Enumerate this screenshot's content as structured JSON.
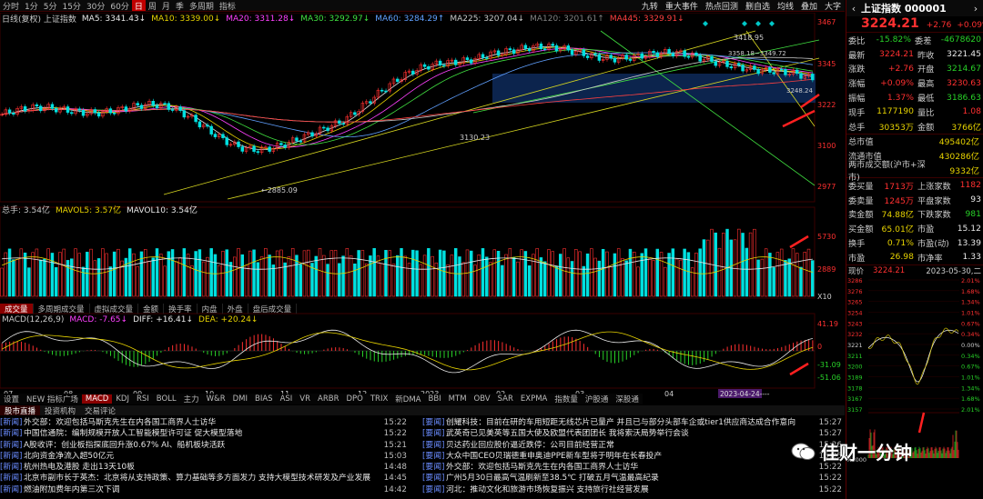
{
  "toolbar": {
    "items": [
      "分时",
      "1分",
      "5分",
      "15分",
      "30分",
      "60分",
      "日",
      "周",
      "月",
      "季",
      "多周期",
      "指标"
    ],
    "active_index": 6,
    "right_items": [
      "九转",
      "重大事件",
      "热点回测",
      "删自选",
      "均线",
      "叠加",
      "大字"
    ]
  },
  "main_legend": [
    {
      "text": "日线(复权) 上证指数",
      "color": "#c8c8c8"
    },
    {
      "text": "MA5: 3341.43↓",
      "color": "#e8e8e8"
    },
    {
      "text": "MA10: 3339.00↓",
      "color": "#e6d200"
    },
    {
      "text": "MA20: 3311.28↓",
      "color": "#ff40ff"
    },
    {
      "text": "MA30: 3292.97↓",
      "color": "#40e040"
    },
    {
      "text": "MA60: 3284.29↑",
      "color": "#60a0ff"
    },
    {
      "text": "MA225: 3207.04↓",
      "color": "#c8c8c8"
    },
    {
      "text": "MA120: 3201.61↑",
      "color": "#808080"
    },
    {
      "text": "MA445: 3329.91↓",
      "color": "#ff4040"
    }
  ],
  "price_axis": [
    "3467",
    "3345",
    "3222",
    "3100",
    "2977"
  ],
  "vol_axis": [
    "5730",
    "2889",
    "X10"
  ],
  "macd_axis": [
    "41.19",
    "0",
    "-31.09",
    "-51.06"
  ],
  "annotations": {
    "high": "3418.95",
    "low": "←2885.09",
    "mid": "3130.23",
    "range": "3358.18~3349.72",
    "tag": "3248.24"
  },
  "vol_legend": [
    {
      "text": "总手: 3.54亿",
      "color": "#c8c8c8"
    },
    {
      "text": "MAVOL5: 3.57亿",
      "color": "#e6d200"
    },
    {
      "text": "MAVOL10: 3.54亿",
      "color": "#e8e8e8"
    }
  ],
  "indicator_tabs": [
    "成交量",
    "多周期成交量",
    "虚拟成交量",
    "金额",
    "换手率",
    "内盘",
    "外盘",
    "盘后成交量"
  ],
  "indicator_tabs_active": 0,
  "macd_legend": [
    {
      "text": "MACD(12,26,9)",
      "color": "#c8c8c8"
    },
    {
      "text": "MACD: -7.65↓",
      "color": "#ff40ff"
    },
    {
      "text": "DIFF: +16.41↓",
      "color": "#e8e8e8"
    },
    {
      "text": "DEA: +20.24↓",
      "color": "#e6d200"
    }
  ],
  "indicator_explain": "指标说明",
  "date_axis": [
    "07",
    "08",
    "09",
    "10",
    "11",
    "12",
    "2023",
    "02",
    "03",
    "04"
  ],
  "date_highlight": "2023-04-24----",
  "bottom_tabs": [
    "设置",
    "NEW 指标广场",
    "MACD",
    "KDJ",
    "RSI",
    "BOLL",
    "主力",
    "W&R",
    "DMI",
    "BIAS",
    "ASI",
    "VR",
    "ARBR",
    "DPO",
    "TRIX",
    "新DMA",
    "BBI",
    "MTM",
    "OBV",
    "SAR",
    "EXPMA",
    "指数量",
    "沪股通",
    "深股通"
  ],
  "bottom_tabs_active": 2,
  "news_tabs": [
    "股市直播",
    "投资机构",
    "交易评论"
  ],
  "news_left": [
    {
      "tag": "[新闻]",
      "title": "外交部：欢迎包括马斯克先生在内各国工商界人士访华",
      "time": "15:22"
    },
    {
      "tag": "[新闻]",
      "title": "中国信通院：编制规模开放人工智能模型许可证 促大模型落地",
      "time": "15:22"
    },
    {
      "tag": "[新闻]",
      "title": "A股收评：创业板指探底回升涨0.67% AI、船机板块活跃",
      "time": "15:21"
    },
    {
      "tag": "[新闻]",
      "title": "北向资金净流入超50亿元",
      "time": "15:03"
    },
    {
      "tag": "[新闻]",
      "title": "杭州热电及港股 走出13天10板",
      "time": "14:48"
    },
    {
      "tag": "[新闻]",
      "title": "北京市副市长于英杰：北京将从支持政策、算力基础等多方面发力 支持大模型技术研发及产业发展",
      "time": "14:45"
    },
    {
      "tag": "[新闻]",
      "title": "燃油附加费年内第三次下调",
      "time": "14:42"
    }
  ],
  "news_right": [
    {
      "tag": "[要闻]",
      "title": "创耀科技：目前在研的车用短距无线芯片已量产 并且已与部分头部车企或tier1供应商达成合作意向",
      "time": "15:27"
    },
    {
      "tag": "[要闻]",
      "title": "武英奇已见美英等五国大使及欧盟代表团团长 我将索沃局势举行会谈",
      "time": "15:27"
    },
    {
      "tag": "[要闻]",
      "title": "贝达药业回应股价逼近跌停：公司目前经营正常",
      "time": "15:26"
    },
    {
      "tag": "[要闻]",
      "title": "大众中国CEO贝瑞德重申奥迪PPE新车型将于明年在长春投产",
      "time": "15:25"
    },
    {
      "tag": "[要闻]",
      "title": "外交部：欢迎包括马斯克先生在内各国工商界人士访华",
      "time": "15:22"
    },
    {
      "tag": "[要闻]",
      "title": "广州5月30日最高气温刷新至38.5℃ 打破五月气温最高纪录",
      "time": "15:22"
    },
    {
      "tag": "[要闻]",
      "title": "河北：推动文化和旅游市场恢复振兴 支持旅行社经营发展",
      "time": "15:22"
    }
  ],
  "quote": {
    "name": "上证指数 000001",
    "price": "3224.21",
    "change": "+2.76",
    "pct": "+0.09%",
    "rows": [
      {
        "l1": "委比",
        "v1": "-15.82%",
        "c1": "grn",
        "l2": "委差",
        "v2": "-4678620",
        "c2": "grn"
      },
      {
        "l1": "最新",
        "v1": "3224.21",
        "c1": "red",
        "l2": "昨收",
        "v2": "3221.45",
        "c2": "wht"
      },
      {
        "l1": "涨跌",
        "v1": "+2.76",
        "c1": "red",
        "l2": "开盘",
        "v2": "3214.67",
        "c2": "grn"
      },
      {
        "l1": "涨幅",
        "v1": "+0.09%",
        "c1": "red",
        "l2": "最高",
        "v2": "3230.63",
        "c2": "red"
      },
      {
        "l1": "振幅",
        "v1": "1.37%",
        "c1": "red",
        "l2": "最低",
        "v2": "3186.63",
        "c2": "grn"
      },
      {
        "l1": "现手",
        "v1": "1177190",
        "c1": "yel",
        "l2": "量比",
        "v2": "1.08",
        "c2": "red"
      },
      {
        "l1": "总手",
        "v1": "30353万",
        "c1": "yel",
        "l2": "金额",
        "v2": "3766亿",
        "c2": "yel"
      }
    ],
    "stats": [
      {
        "l": "总市值",
        "v": "495402亿",
        "c": "yel"
      },
      {
        "l": "流通市值",
        "v": "430286亿",
        "c": "yel"
      },
      {
        "l": "两市成交额(沪市+深市)",
        "v": "9332亿",
        "c": "yel"
      }
    ],
    "rows2": [
      {
        "l1": "委买量",
        "v1": "1713万",
        "c1": "red",
        "l2": "上涨家数",
        "v2": "1182",
        "c2": "red"
      },
      {
        "l1": "委卖量",
        "v1": "1245万",
        "c1": "red",
        "l2": "平盘家数",
        "v2": "93",
        "c2": "wht"
      },
      {
        "l1": "卖金额",
        "v1": "74.88亿",
        "c1": "yel",
        "l2": "下跌家数",
        "v2": "981",
        "c2": "grn"
      },
      {
        "l1": "买金额",
        "v1": "65.01亿",
        "c1": "yel",
        "l2": "市盈",
        "v2": "15.12",
        "c2": "wht"
      },
      {
        "l1": "换手",
        "v1": "0.71%",
        "c1": "yel",
        "l2": "市盈(动)",
        "v2": "13.39",
        "c2": "wht"
      },
      {
        "l1": "市盈",
        "v1": "26.98",
        "c1": "yel",
        "l2": "市净率",
        "v2": "1.33",
        "c2": "wht"
      }
    ],
    "mini": {
      "label": "现价",
      "price": "3224.21",
      "date": "2023-05-30,二",
      "left_axis": [
        "3286",
        "3276",
        "3265",
        "3254",
        "3243",
        "3232",
        "3221",
        "3211",
        "3200",
        "3189",
        "3178",
        "3167",
        "3157"
      ],
      "right_axis": [
        "2.01%",
        "1.68%",
        "1.34%",
        "1.01%",
        "0.67%",
        "0.34%",
        "0.00%",
        "0.34%",
        "0.67%",
        "1.01%",
        "1.34%",
        "1.68%",
        "2.01%"
      ],
      "vol_label": "X1000"
    }
  },
  "watermark": "佳财一分钟",
  "colors": {
    "up": "#ff3030",
    "down": "#00e0e0",
    "bg": "#000000",
    "grid": "#3a0000"
  }
}
